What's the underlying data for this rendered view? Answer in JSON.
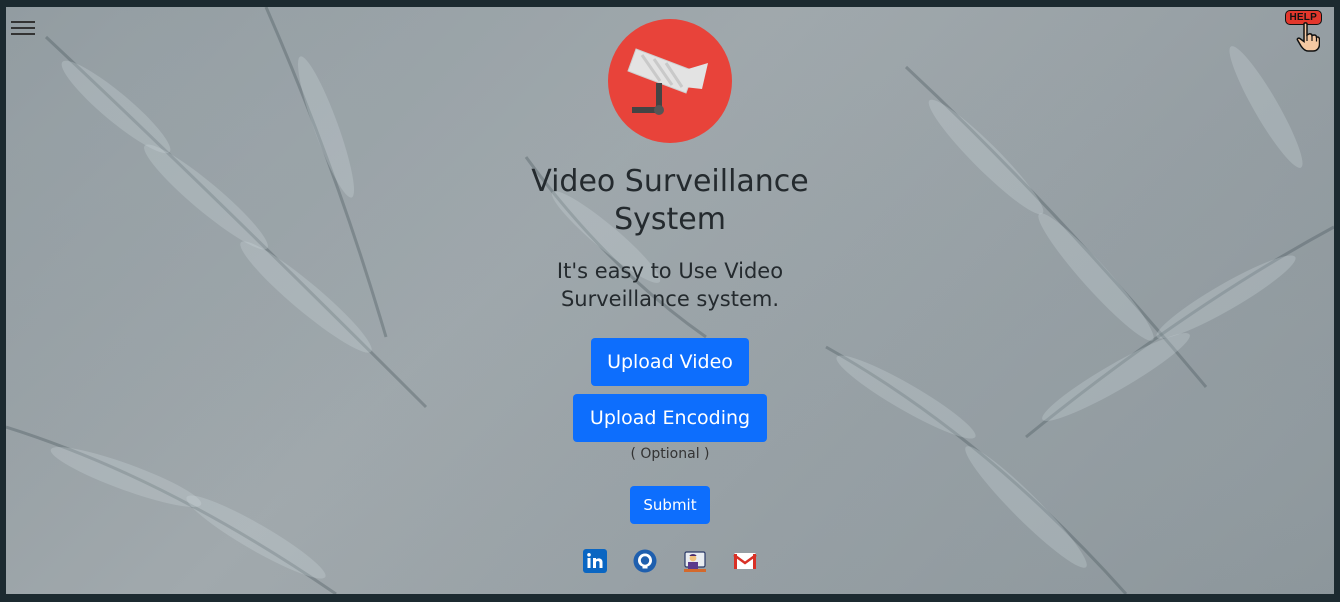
{
  "header": {
    "menu_icon": "hamburger-icon",
    "help_label": "HELP",
    "help_icon": "pointer-hand-icon"
  },
  "hero": {
    "logo_icon": "security-camera-icon",
    "title": "Video Surveillance System",
    "subtitle": "It's easy to Use Video Surveillance system."
  },
  "actions": {
    "upload_video_label": "Upload Video",
    "upload_encoding_label": "Upload Encoding",
    "optional_note": "( Optional )",
    "submit_label": "Submit"
  },
  "socials": [
    {
      "icon": "linkedin-icon"
    },
    {
      "icon": "github-icon"
    },
    {
      "icon": "portfolio-icon"
    },
    {
      "icon": "gmail-icon"
    }
  ],
  "colors": {
    "primary": "#0d6efd",
    "logo_bg": "#e8433a",
    "help_badge": "#e2372c",
    "text": "#242a2e"
  }
}
